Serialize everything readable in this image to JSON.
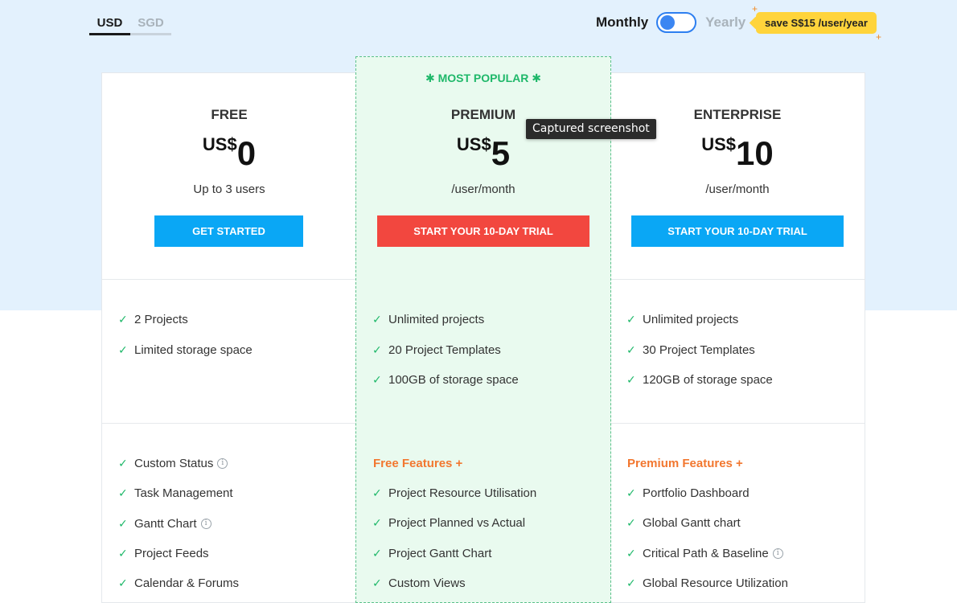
{
  "currency_tabs": [
    "USD",
    "SGD"
  ],
  "billing": {
    "monthly_label": "Monthly",
    "yearly_label": "Yearly",
    "save_badge": "save S$15 /user/year"
  },
  "popular_label": "✱ MOST POPULAR ✱",
  "tooltip": "Captured screenshot",
  "plans": [
    {
      "name": "FREE",
      "currency": "US$",
      "price": "0",
      "subtext": "Up to 3 users",
      "cta": "GET STARTED",
      "features": [
        "2 Projects",
        "Limited storage space"
      ],
      "extras_heading": "",
      "extras": [
        "Custom Status",
        "Task Management",
        "Gantt Chart",
        "Project Feeds",
        "Calendar & Forums"
      ]
    },
    {
      "name": "PREMIUM",
      "currency": "US$",
      "price": "5",
      "subtext": "/user/month",
      "cta": "START YOUR 10-DAY TRIAL",
      "features": [
        "Unlimited projects",
        "20 Project Templates",
        "100GB of storage space"
      ],
      "extras_heading": "Free Features +",
      "extras": [
        "Project Resource Utilisation",
        "Project Planned vs Actual",
        "Project Gantt Chart",
        "Custom Views"
      ]
    },
    {
      "name": "ENTERPRISE",
      "currency": "US$",
      "price": "10",
      "subtext": "/user/month",
      "cta": "START YOUR 10-DAY TRIAL",
      "features": [
        "Unlimited projects",
        "30 Project Templates",
        "120GB of storage space"
      ],
      "extras_heading": "Premium Features +",
      "extras": [
        "Portfolio Dashboard",
        "Global Gantt chart",
        "Critical Path & Baseline",
        "Global Resource Utilization"
      ]
    }
  ],
  "colors": {
    "band": "#e3f1fd",
    "cta_blue": "#0aa7f5",
    "cta_red": "#f2473f",
    "check_green": "#1fb86a",
    "heading_orange": "#f2772f",
    "badge_yellow": "#ffd43b"
  }
}
